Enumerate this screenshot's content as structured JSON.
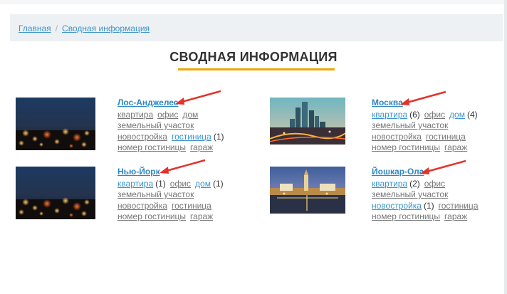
{
  "breadcrumb": {
    "home": "Главная",
    "separator": "/",
    "current": "Сводная информация"
  },
  "title": "СВОДНАЯ ИНФОРМАЦИЯ",
  "colors": {
    "accent": "#f0a500",
    "link": "#3d94c9",
    "muted_link": "#777777",
    "arrow": "#e4322b"
  },
  "cities": [
    {
      "name": "Лос-Анджелес",
      "image": "city-night-bokeh",
      "rows": [
        [
          {
            "label": "квартира"
          },
          {
            "label": "офис"
          },
          {
            "label": "дом"
          }
        ],
        [
          {
            "label": "земельный участок"
          }
        ],
        [
          {
            "label": "новостройка"
          },
          {
            "label": "гостиница",
            "active": true,
            "count": "(1)"
          }
        ],
        [
          {
            "label": "номер гостиницы"
          },
          {
            "label": "гараж"
          }
        ]
      ]
    },
    {
      "name": "Москва",
      "image": "moscow-city-towers",
      "rows": [
        [
          {
            "label": "квартира",
            "active": true,
            "count": "(6)"
          },
          {
            "label": "офис"
          },
          {
            "label": "дом",
            "active": true,
            "count": "(4)"
          }
        ],
        [
          {
            "label": "земельный участок"
          }
        ],
        [
          {
            "label": "новостройка"
          },
          {
            "label": "гостиница"
          }
        ],
        [
          {
            "label": "номер гостиницы"
          },
          {
            "label": "гараж"
          }
        ]
      ]
    },
    {
      "name": "Нью-Йорк",
      "image": "city-night-bokeh",
      "rows": [
        [
          {
            "label": "квартира",
            "active": true,
            "count": "(1)"
          },
          {
            "label": "офис"
          },
          {
            "label": "дом",
            "active": true,
            "count": "(1)"
          }
        ],
        [
          {
            "label": "земельный участок"
          }
        ],
        [
          {
            "label": "новостройка"
          },
          {
            "label": "гостиница"
          }
        ],
        [
          {
            "label": "номер гостиницы"
          },
          {
            "label": "гараж"
          }
        ]
      ]
    },
    {
      "name": "Йошкар-Ола",
      "image": "yoshkar-ola-evening",
      "rows": [
        [
          {
            "label": "квартира",
            "active": true,
            "count": "(2)"
          },
          {
            "label": "офис"
          }
        ],
        [
          {
            "label": "земельный участок"
          }
        ],
        [
          {
            "label": "новостройка",
            "active": true,
            "count": "(1)"
          },
          {
            "label": "гостиница"
          }
        ],
        [
          {
            "label": "номер гостиницы"
          },
          {
            "label": "гараж"
          }
        ]
      ]
    }
  ]
}
